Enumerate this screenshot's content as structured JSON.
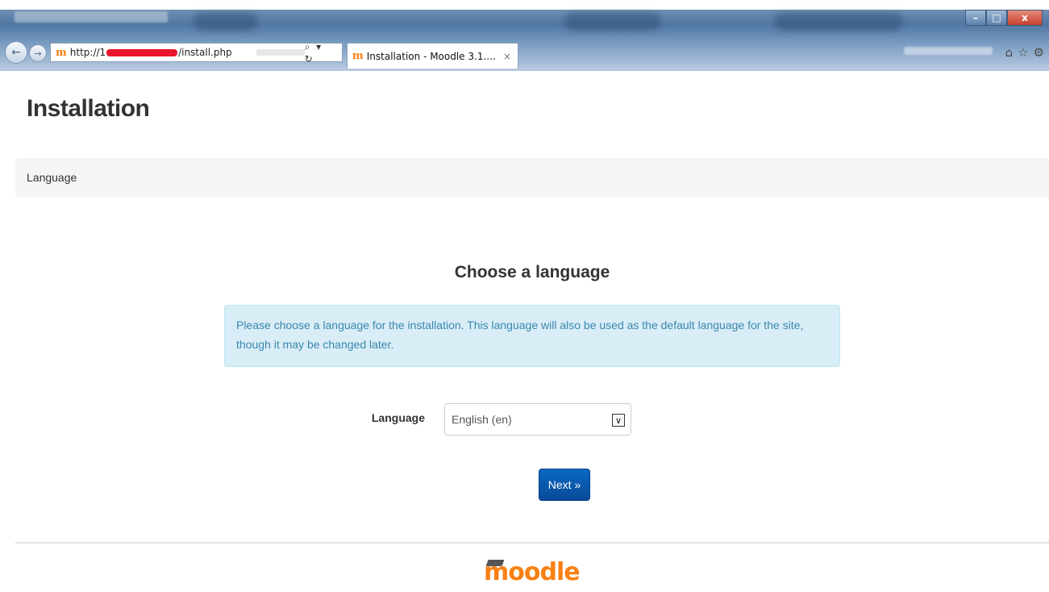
{
  "browser": {
    "url_prefix": "http://1",
    "url_suffix": "/install.php",
    "address_tools": "⌕ ▾ ↻",
    "tab_title": "Installation - Moodle 3.1....",
    "tab_close": "×",
    "window_controls": [
      "–",
      "□",
      "x"
    ],
    "right_tools": [
      "⌂",
      "☆",
      "⚙"
    ],
    "favicon": "m"
  },
  "page": {
    "title": "Installation",
    "breadcrumb": "Language",
    "heading": "Choose a language",
    "alert_text": "Please choose a language for the installation. This language will also be used as the default language for the site, though it may be changed later."
  },
  "form": {
    "language_label": "Language",
    "language_value": "English (en)",
    "next_label": "Next »"
  },
  "footer": {
    "logo_text": "moodle"
  },
  "colors": {
    "moodle_orange": "#f98012",
    "primary_button": "#0a5bb0",
    "alert_bg": "#d9edf7",
    "alert_text": "#3a87ad"
  }
}
